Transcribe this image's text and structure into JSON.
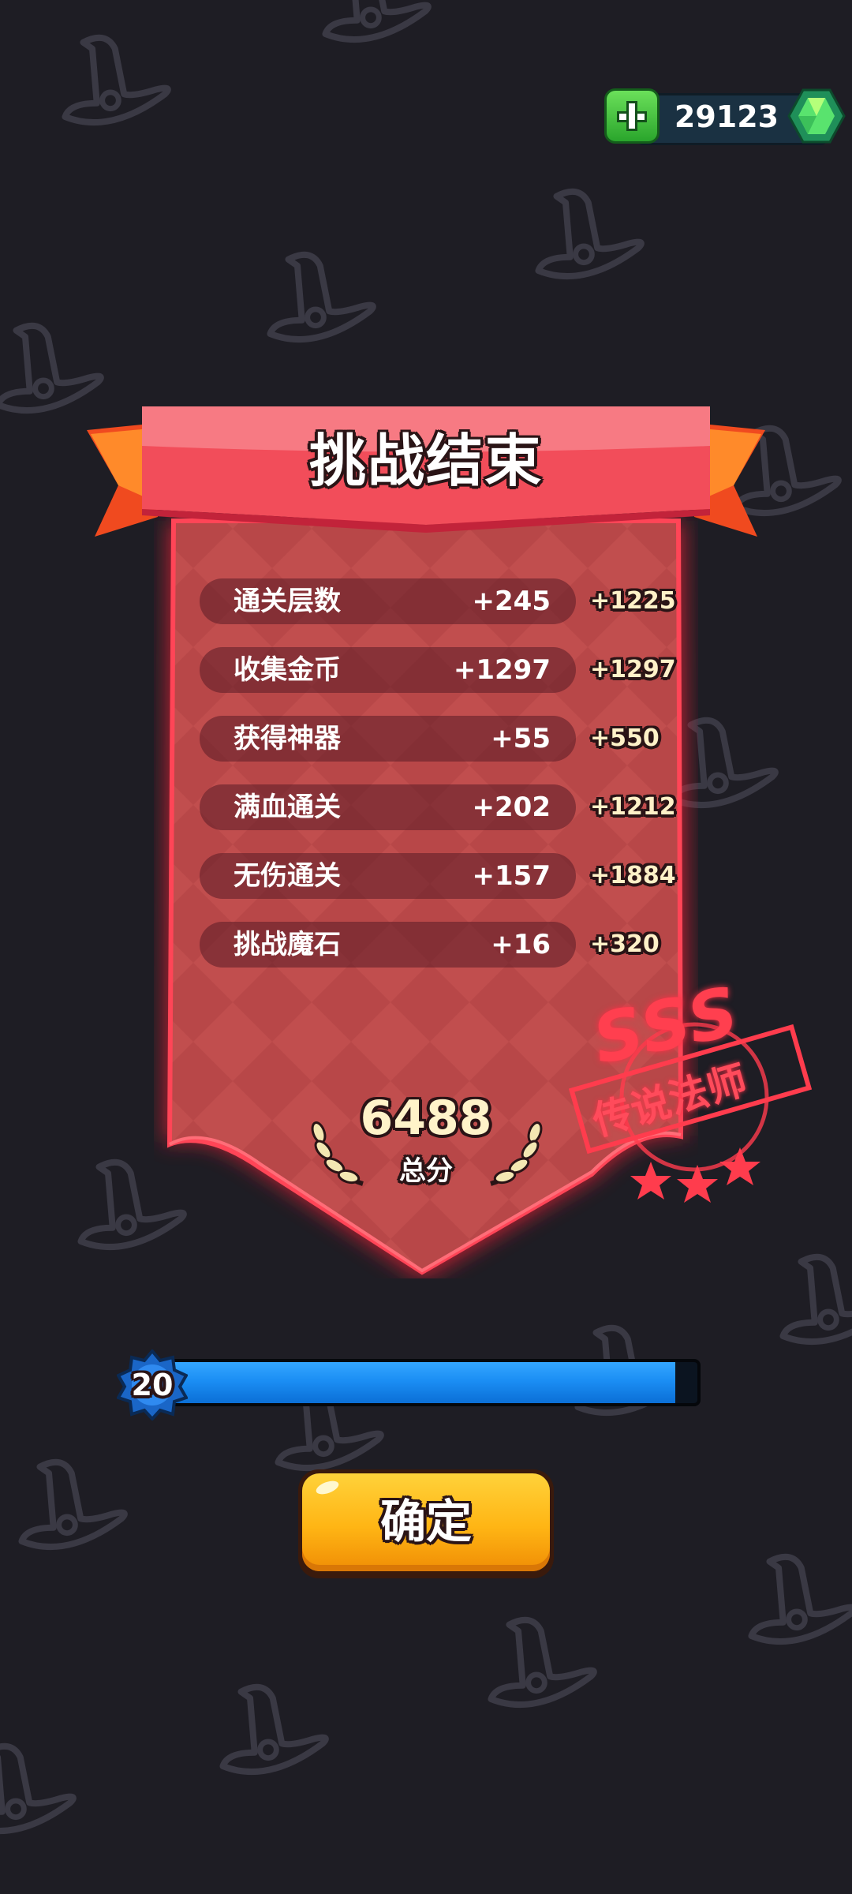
{
  "header": {
    "gem_amount": "29123"
  },
  "title": "挑战结束",
  "stats": [
    {
      "label": "通关层数",
      "count": "+245",
      "score": "+1225"
    },
    {
      "label": "收集金币",
      "count": "+1297",
      "score": "+1297"
    },
    {
      "label": "获得神器",
      "count": "+55",
      "score": "+550"
    },
    {
      "label": "满血通关",
      "count": "+202",
      "score": "+1212"
    },
    {
      "label": "无伤通关",
      "count": "+157",
      "score": "+1884"
    },
    {
      "label": "挑战魔石",
      "count": "+16",
      "score": "+320"
    }
  ],
  "total": {
    "value": "6488",
    "label": "总分"
  },
  "rank": {
    "grade": "SSS",
    "title": "传说法师",
    "stars": 3
  },
  "level": {
    "number": "20",
    "progress": 0.96
  },
  "confirm_label": "确定",
  "colors": {
    "accent": "#f0434f",
    "gem": "#3ad17a",
    "level_bar": "#1b8ef4",
    "button": "#ffb514"
  },
  "icons": {
    "add": "plus-icon",
    "currency": "gem-icon",
    "background": "witch-hat-icon"
  }
}
